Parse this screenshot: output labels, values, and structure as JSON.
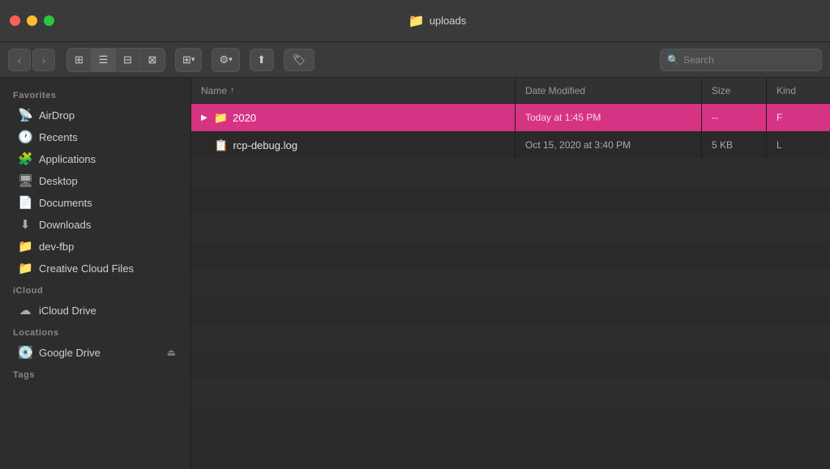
{
  "window": {
    "title": "uploads",
    "traffic_lights": {
      "red": "close",
      "yellow": "minimize",
      "green": "maximize"
    }
  },
  "toolbar": {
    "nav": {
      "back_label": "‹",
      "forward_label": "›"
    },
    "view_modes": [
      {
        "label": "⊞",
        "name": "icon-view",
        "active": false
      },
      {
        "label": "≡",
        "name": "list-view",
        "active": true
      },
      {
        "label": "⊟",
        "name": "column-view",
        "active": false
      },
      {
        "label": "⊠",
        "name": "gallery-view",
        "active": false
      }
    ],
    "group_btn": "⊞▾",
    "action_btn": "⚙▾",
    "share_btn": "↑",
    "tag_btn": "🏷",
    "search_placeholder": "Search"
  },
  "sidebar": {
    "sections": [
      {
        "label": "Favorites",
        "items": [
          {
            "name": "airdrop",
            "label": "AirDrop",
            "icon": "📡"
          },
          {
            "name": "recents",
            "label": "Recents",
            "icon": "🕐"
          },
          {
            "name": "applications",
            "label": "Applications",
            "icon": "🧩"
          },
          {
            "name": "desktop",
            "label": "Desktop",
            "icon": "🖥"
          },
          {
            "name": "documents",
            "label": "Documents",
            "icon": "📄"
          },
          {
            "name": "downloads",
            "label": "Downloads",
            "icon": "⬇"
          },
          {
            "name": "dev-fbp",
            "label": "dev-fbp",
            "icon": "📁"
          },
          {
            "name": "creative-cloud",
            "label": "Creative Cloud Files",
            "icon": "📁"
          }
        ]
      },
      {
        "label": "iCloud",
        "items": [
          {
            "name": "icloud-drive",
            "label": "iCloud Drive",
            "icon": "☁"
          }
        ]
      },
      {
        "label": "Locations",
        "items": [
          {
            "name": "google-drive",
            "label": "Google Drive",
            "icon": "💽",
            "eject": true
          }
        ]
      },
      {
        "label": "Tags",
        "items": []
      }
    ]
  },
  "file_browser": {
    "columns": [
      {
        "key": "name",
        "label": "Name",
        "sortable": true,
        "sorted": true,
        "sort_dir": "asc"
      },
      {
        "key": "date_modified",
        "label": "Date Modified",
        "sortable": true
      },
      {
        "key": "size",
        "label": "Size",
        "sortable": true
      },
      {
        "key": "kind",
        "label": "Kind",
        "sortable": true
      }
    ],
    "files": [
      {
        "id": "row-2020",
        "name": "2020",
        "type": "folder",
        "date_modified": "Today at 1:45 PM",
        "size": "--",
        "kind": "F",
        "selected": true,
        "expanded": false
      },
      {
        "id": "row-rcp-debug",
        "name": "rcp-debug.log",
        "type": "file",
        "date_modified": "Oct 15, 2020 at 3:40 PM",
        "size": "5 KB",
        "kind": "L",
        "selected": false,
        "expanded": false
      }
    ]
  }
}
